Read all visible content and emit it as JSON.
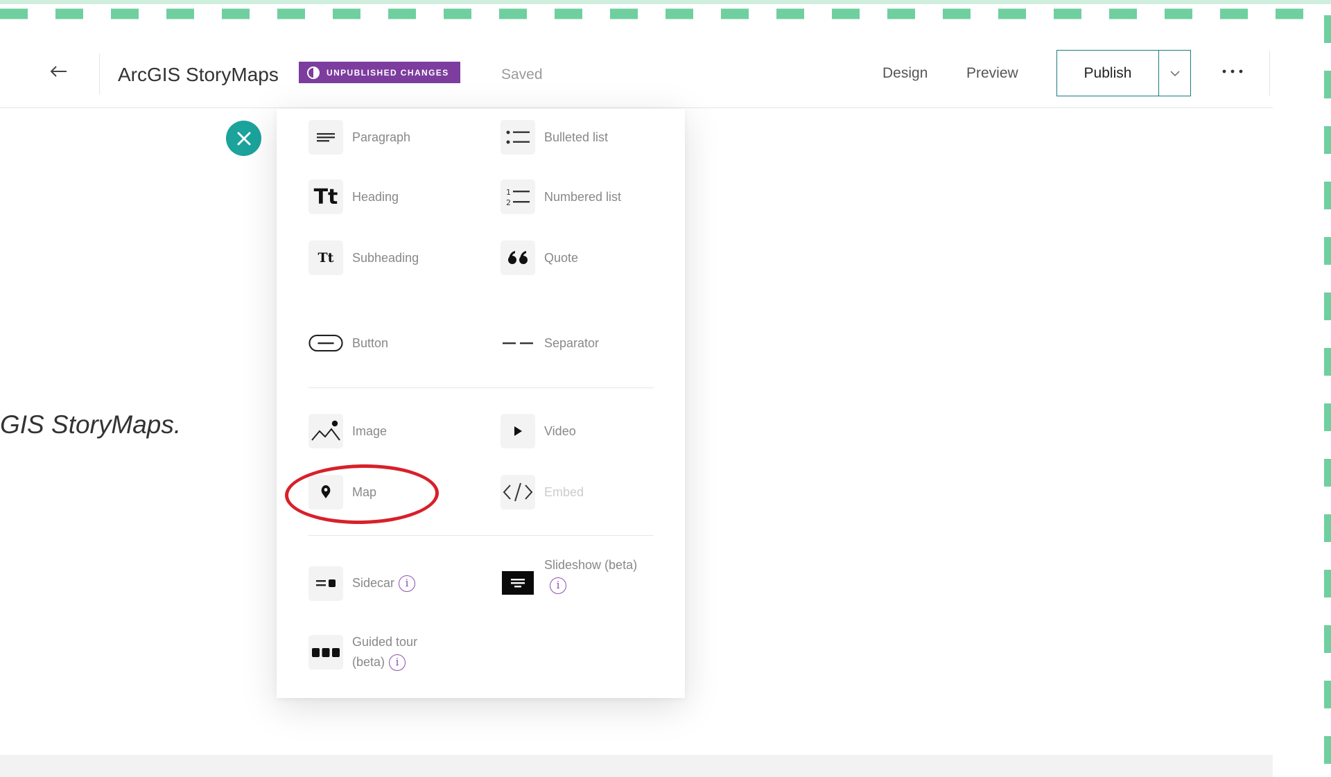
{
  "header": {
    "back_icon": "arrow-left-icon",
    "app_title": "ArcGIS StoryMaps",
    "badge_label": "UNPUBLISHED CHANGES",
    "status": "Saved",
    "nav": {
      "design": "Design",
      "preview": "Preview"
    },
    "publish_label": "Publish",
    "more_icon": "more-horizontal-icon"
  },
  "background": {
    "text_fragment": "GIS StoryMaps."
  },
  "menu": {
    "items": {
      "paragraph": "Paragraph",
      "bulleted_list": "Bulleted list",
      "heading": "Heading",
      "heading_glyph": "Tt",
      "numbered_list": "Numbered list",
      "subheading": "Subheading",
      "subheading_glyph": "Tt",
      "quote": "Quote",
      "button": "Button",
      "separator": "Separator",
      "image": "Image",
      "video": "Video",
      "map": "Map",
      "embed": "Embed",
      "sidecar": "Sidecar",
      "slideshow": "Slideshow (beta)",
      "guided_tour": "Guided tour (beta)"
    },
    "info_glyph": "i"
  },
  "colors": {
    "accent_teal": "#1ba39c",
    "badge_purple": "#7c3d9e",
    "annotation_red": "#d8202a",
    "frame_green": "#6fcf9f"
  }
}
